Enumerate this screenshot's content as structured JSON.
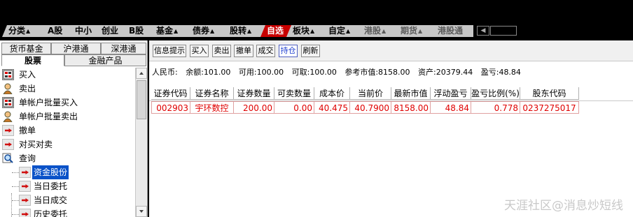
{
  "tabbar": {
    "tabs": [
      {
        "label": "分类",
        "arrow": "▲"
      },
      {
        "label": "A股",
        "arrow": ""
      },
      {
        "label": "中小",
        "arrow": ""
      },
      {
        "label": "创业",
        "arrow": ""
      },
      {
        "label": "B股",
        "arrow": ""
      },
      {
        "label": "基金",
        "arrow": "▲"
      },
      {
        "label": "债券",
        "arrow": "▲"
      },
      {
        "label": "股转",
        "arrow": "▲"
      },
      {
        "label": "自选",
        "arrow": ""
      },
      {
        "label": "板块",
        "arrow": "▲"
      },
      {
        "label": "自定",
        "arrow": "▲"
      },
      {
        "label": "港股",
        "arrow": "▲"
      },
      {
        "label": "期货",
        "arrow": "▲"
      },
      {
        "label": "港股通",
        "arrow": ""
      }
    ],
    "nav_prev": "◀"
  },
  "left": {
    "tabs_row1": [
      "货币基金",
      "沪港通",
      "深港通"
    ],
    "tabs_row2": [
      "股票",
      "金融产品"
    ],
    "tree": [
      {
        "label": "买入",
        "icon": "buy-icon"
      },
      {
        "label": "卖出",
        "icon": "sell-person-icon"
      },
      {
        "label": "单帐户批量买入",
        "icon": "batch-buy-icon"
      },
      {
        "label": "单帐户批量卖出",
        "icon": "batch-sell-icon"
      },
      {
        "label": "撤单",
        "icon": "cancel-arrow-icon"
      },
      {
        "label": "对买对卖",
        "icon": "cross-trade-arrow-icon"
      },
      {
        "label": "查询",
        "icon": "magnifier-icon"
      },
      {
        "label": "资金股份",
        "icon": "arrow-icon"
      },
      {
        "label": "当日委托",
        "icon": "arrow-icon"
      },
      {
        "label": "当日成交",
        "icon": "arrow-icon"
      },
      {
        "label": "历史委托",
        "icon": "arrow-icon"
      }
    ],
    "selected": "资金股份"
  },
  "toolbar": {
    "buttons": [
      "信息提示",
      "买入",
      "卖出",
      "撤单",
      "成交",
      "持仓",
      "刷新"
    ],
    "active": "持仓"
  },
  "summary": {
    "currency": "人民币:",
    "balance": "余额:101.00",
    "available": "可用:100.00",
    "withdrawable": "可取:100.00",
    "reference_value": "参考市值:8158.00",
    "assets": "资产:20379.44",
    "profit_loss": "盈亏:48.84"
  },
  "table": {
    "headers": [
      "证券代码",
      "证券名称",
      "证券数量",
      "可卖数量",
      "成本价",
      "当前价",
      "最新市值",
      "浮动盈亏",
      "盈亏比例(%)",
      "股东代码"
    ],
    "rows": [
      [
        "002903",
        "宇环数控",
        "200.00",
        "0.00",
        "40.475",
        "40.7900",
        "8158.00",
        "48.84",
        "0.778",
        "0237275017"
      ]
    ]
  },
  "watermark": "天涯社区@消息炒短线",
  "colors": {
    "active_tab": "#c80000",
    "selected_item": "#0a52c8",
    "row_text": "#e00000",
    "active_button_text": "#2040d0"
  }
}
